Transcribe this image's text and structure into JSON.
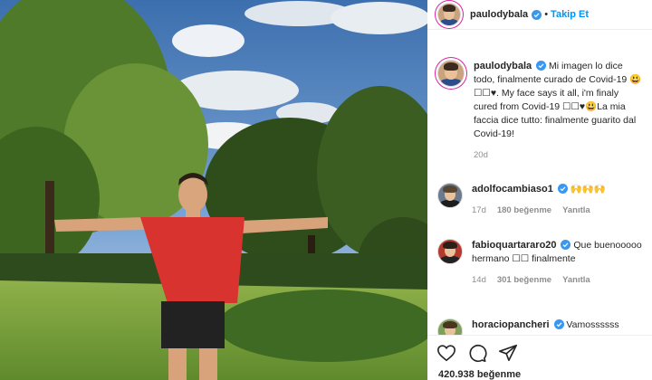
{
  "post": {
    "author": "paulodybala",
    "follow_label": "Takip Et",
    "separator": "•",
    "photo_icon": "photo-of-man-celebrating-in-park"
  },
  "caption": {
    "username": "paulodybala",
    "text": "Mi imagen lo dice todo, finalmente curado de Covid-19 😃☐☐♥. My face says it all, i'm finaly cured from Covid-19 ☐☐♥😃La mia faccia dice tutto: finalmente guarito dal Covid-19!",
    "age": "20d"
  },
  "comments": [
    {
      "username": "adolfocambiaso1",
      "text": "🙌🙌🙌",
      "age": "17d",
      "likes": "180 beğenme",
      "reply": "Yanıtla"
    },
    {
      "username": "fabioquartararo20",
      "text": "Que buenooooo hermano ☐☐ finalmente",
      "age": "14d",
      "likes": "301 beğenme",
      "reply": "Yanıtla"
    },
    {
      "username": "horaciopancheri",
      "text": "Vamossssss"
    }
  ],
  "actions": {
    "like_icon": "heart-icon",
    "comment_icon": "comment-icon",
    "share_icon": "share-icon",
    "like_count": "420.938 beğenme"
  },
  "colors": {
    "accent": "#0095f6",
    "text": "#262626",
    "muted": "#8e8e8e",
    "border": "#efefef"
  }
}
